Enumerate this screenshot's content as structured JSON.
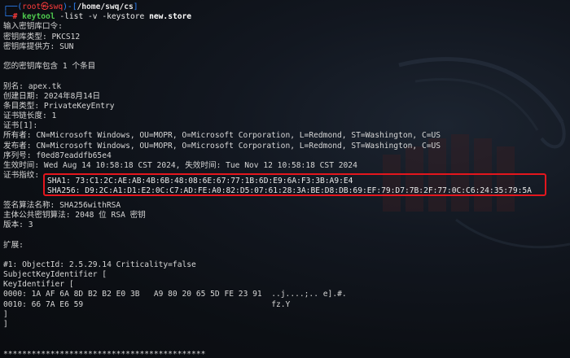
{
  "prompt": {
    "open": "┌──(",
    "user": "root",
    "skull": "㉿",
    "host": "swq",
    "mid": ")-[",
    "path": "/home/swq/cs",
    "close": "]",
    "hash_prefix": "└─",
    "hash": "#",
    "command": "keytool",
    "args": "-list -v -keystore",
    "file": "new.store"
  },
  "output": {
    "lines": [
      "输入密钥库口令:",
      "密钥库类型: PKCS12",
      "密钥库提供方: SUN",
      "",
      "您的密钥库包含 1 个条目",
      "",
      "别名: apex.tk",
      "创建日期: 2024年8月14日",
      "条目类型: PrivateKeyEntry",
      "证书链长度: 1",
      "证书[1]:",
      "所有者: CN=Microsoft Windows, OU=MOPR, O=Microsoft Corporation, L=Redmond, ST=Washington, C=US",
      "发布者: CN=Microsoft Windows, OU=MOPR, O=Microsoft Corporation, L=Redmond, ST=Washington, C=US",
      "序列号: f0ed87eaddfb65e4",
      "生效时间: Wed Aug 14 10:58:18 CST 2024, 失效时间: Tue Nov 12 10:58:18 CST 2024",
      "证书指纹:"
    ],
    "fingerprint_sha1": "SHA1: 73:C1:2C:AE:AB:4B:6B:48:08:6E:67:77:1B:6D:E9:6A:F3:3B:A9:E4",
    "fingerprint_sha256": "SHA256: D9:2C:A1:D1:E2:0C:C7:AD:FE:A0:82:D5:07:61:28:3A:BE:D8:DB:69:EF:79:D7:7B:2F:77:0C:C6:24:35:79:5A",
    "lines_after": [
      "签名算法名称: SHA256withRSA",
      "主体公共密钥算法: 2048 位 RSA 密钥",
      "版本: 3",
      "",
      "扩展:",
      "",
      "#1: ObjectId: 2.5.29.14 Criticality=false",
      "SubjectKeyIdentifier [",
      "KeyIdentifier [",
      "0000: 1A AF 6A 8D B2 B2 E0 3B   A9 80 20 65 5D FE 23 91  ..j....;.. e].#.",
      "0010: 66 7A E6 59                                        fz.Y",
      "]",
      "]",
      "",
      "",
      "*******************************************"
    ]
  },
  "colors": {
    "prompt_frame": "#2e86ff",
    "root_user": "#ff3c3c",
    "command": "#4ec94e",
    "highlight_border": "#e4161d",
    "background": "#0f1117"
  },
  "icons": [
    "kali-dragon-logo-watermark"
  ]
}
